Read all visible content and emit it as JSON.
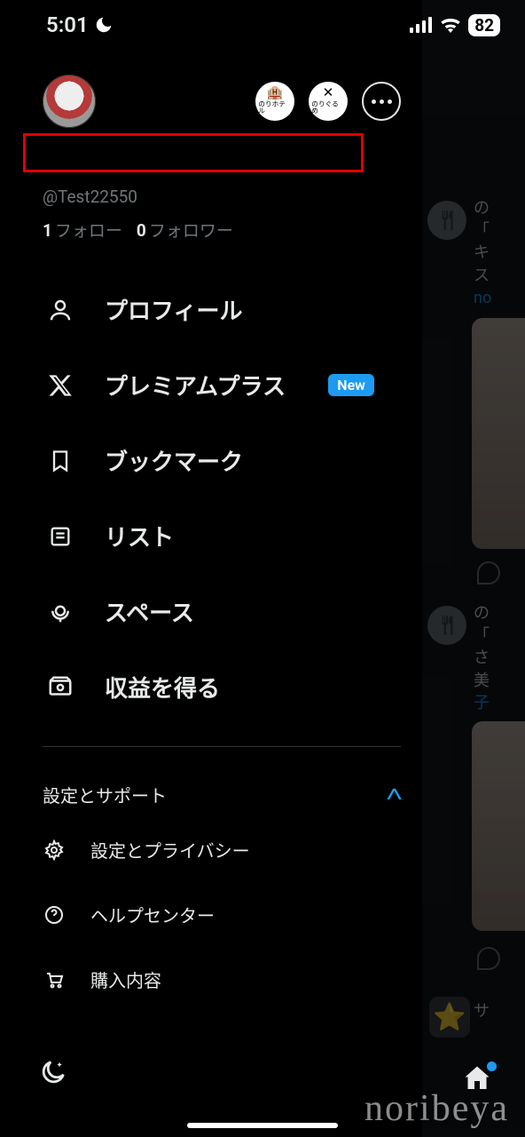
{
  "statusbar": {
    "time": "5:01",
    "battery": "82"
  },
  "account": {
    "handle": "@Test22550",
    "following_count": "1",
    "following_label": "フォロー",
    "followers_count": "0",
    "followers_label": "フォロワー"
  },
  "header_buttons": {
    "hotel_label": "のりホテル",
    "gourmet_label": "のりぐるめ"
  },
  "nav": [
    {
      "key": "profile",
      "label": "プロフィール"
    },
    {
      "key": "premium",
      "label": "プレミアムプラス",
      "badge": "New"
    },
    {
      "key": "bookmarks",
      "label": "ブックマーク"
    },
    {
      "key": "lists",
      "label": "リスト"
    },
    {
      "key": "spaces",
      "label": "スペース"
    },
    {
      "key": "monetize",
      "label": "収益を得る"
    }
  ],
  "settings_section": {
    "title": "設定とサポート",
    "items": [
      {
        "key": "settings",
        "label": "設定とプライバシー"
      },
      {
        "key": "help",
        "label": "ヘルプセンター"
      },
      {
        "key": "purchases",
        "label": "購入内容"
      }
    ]
  },
  "feed_preview": {
    "name1": "の",
    "line1a": "「",
    "line1b": "キ",
    "line1c": "ス",
    "link1": "no",
    "name2": "の",
    "line2a": "「",
    "line2b": "さ",
    "line2c": "美",
    "link2": "子",
    "promoted": "サ"
  },
  "watermark": "noribeya"
}
